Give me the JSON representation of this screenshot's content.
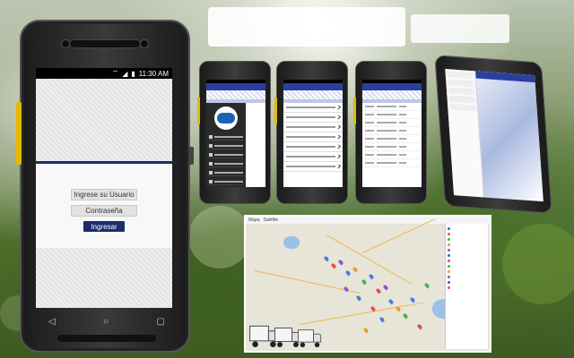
{
  "login_phone": {
    "status_time": "11:30 AM",
    "username_placeholder": "Ingrese su Usuario",
    "password_placeholder": "Contraseña",
    "login_button": "Ingresar"
  },
  "map": {
    "toolbar": [
      "Mapa",
      "Satélite"
    ]
  },
  "colors": {
    "app_bar": "#2b3f9e",
    "login_button": "#1c2a6e",
    "accent_yellow": "#e6b800"
  }
}
